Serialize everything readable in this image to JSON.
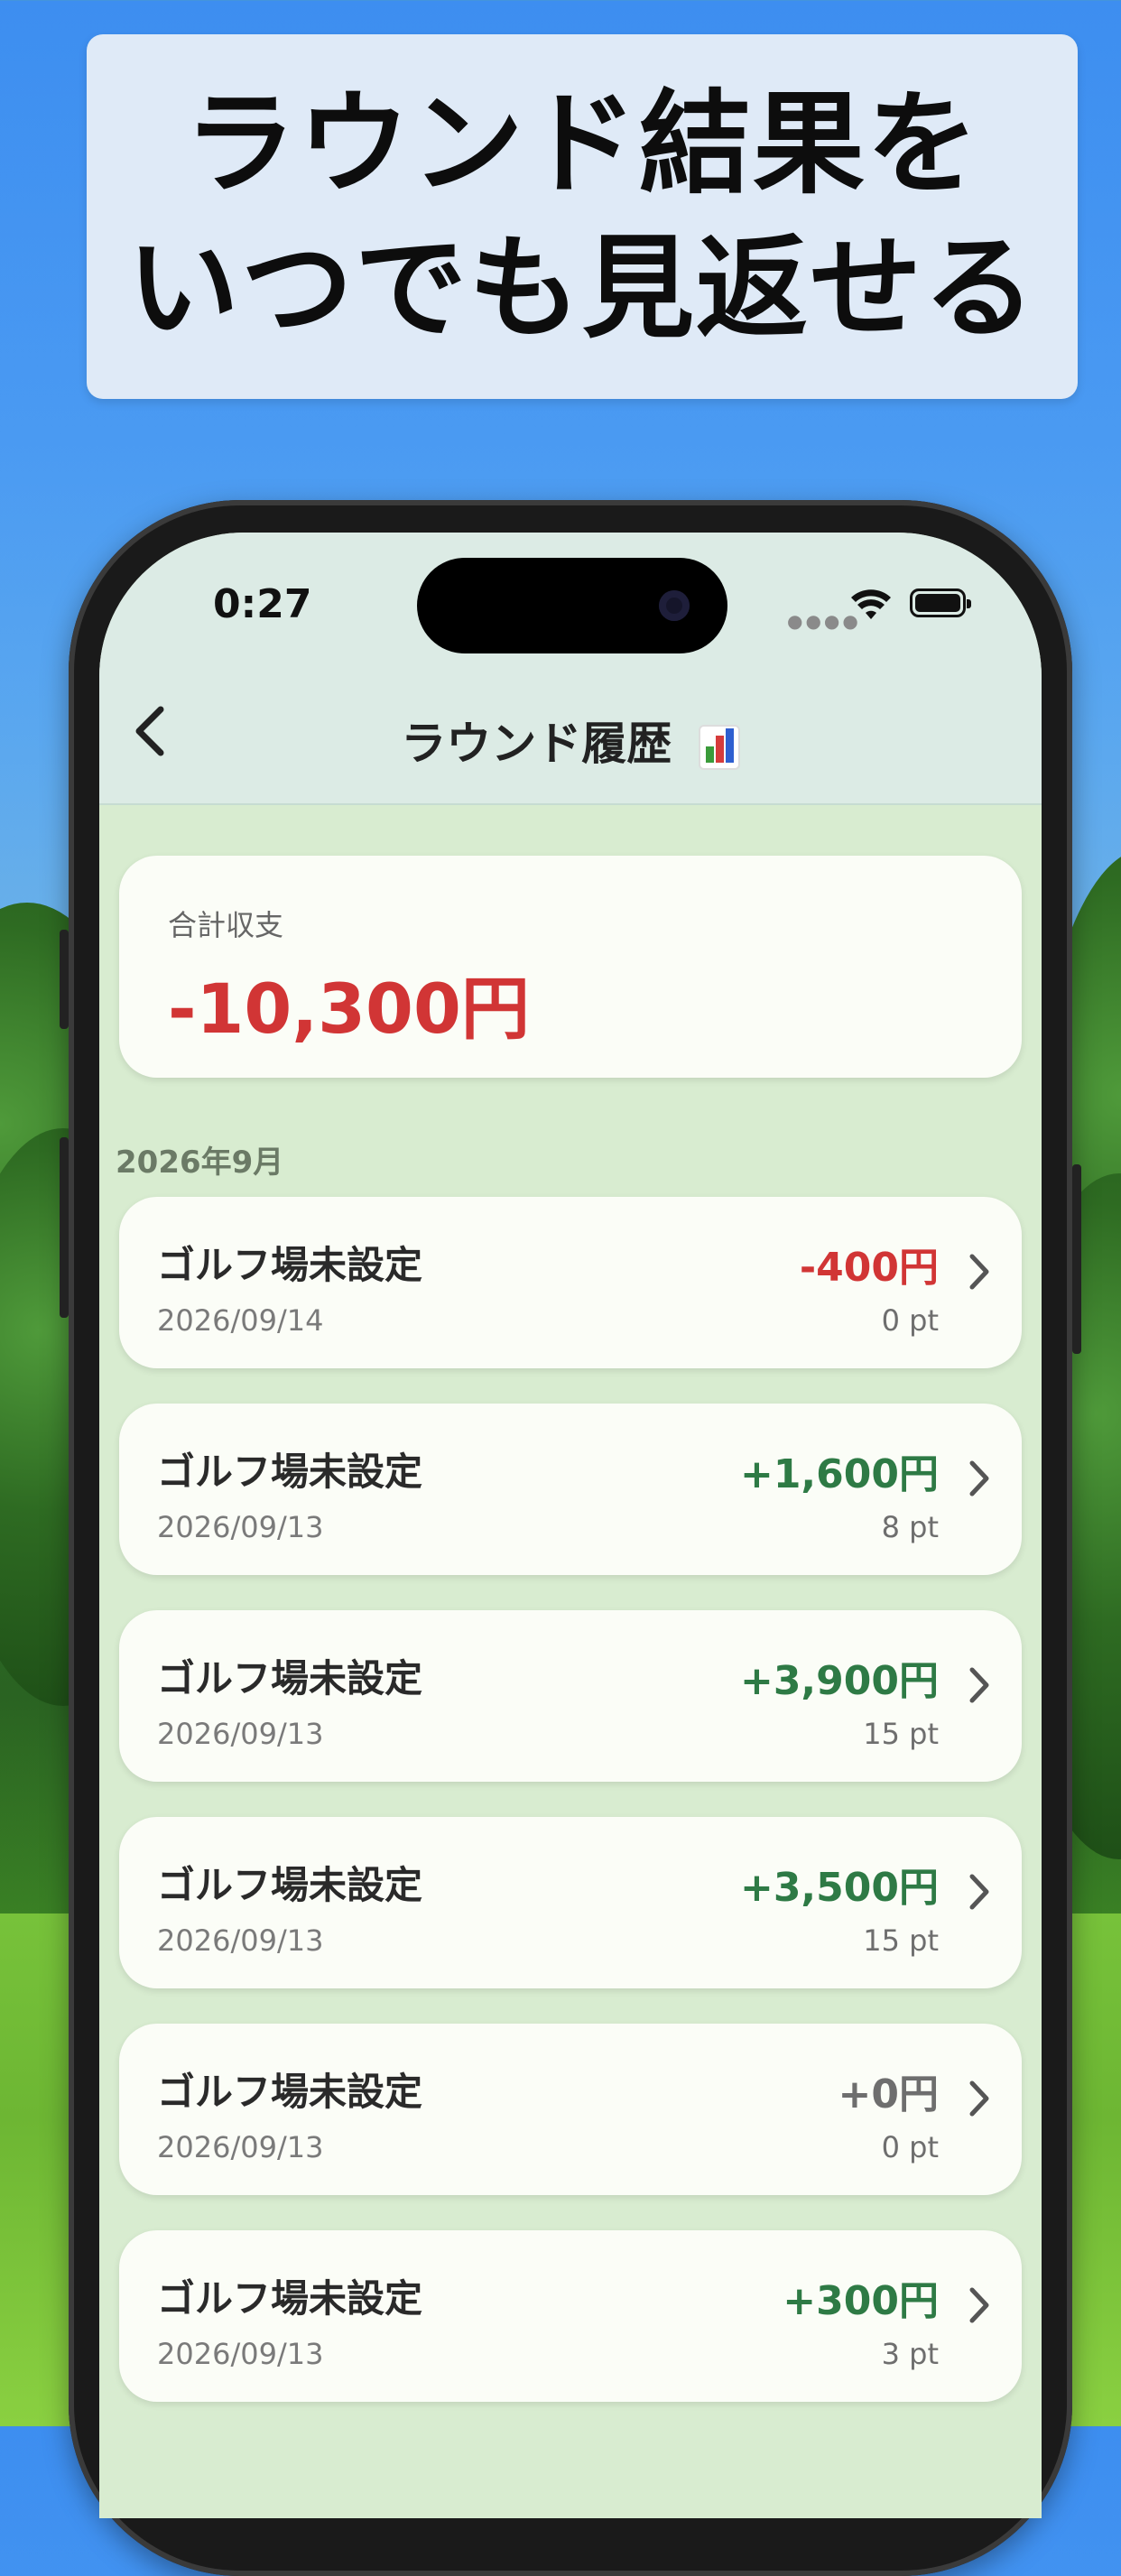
{
  "banner": {
    "line1": "ラウンド結果を",
    "line2": "いつでも見返せる"
  },
  "status": {
    "time": "0:27"
  },
  "nav": {
    "back_glyph": "‹",
    "title": "ラウンド履歴"
  },
  "summary": {
    "label": "合計収支",
    "value": "-10,300円"
  },
  "section_header": "2026年9月",
  "rounds": [
    {
      "name": "ゴルフ場未設定",
      "date": "2026/09/14",
      "amount": "-400円",
      "points": "0 pt",
      "tone": "negative"
    },
    {
      "name": "ゴルフ場未設定",
      "date": "2026/09/13",
      "amount": "+1,600円",
      "points": "8 pt",
      "tone": "positive"
    },
    {
      "name": "ゴルフ場未設定",
      "date": "2026/09/13",
      "amount": "+3,900円",
      "points": "15 pt",
      "tone": "positive"
    },
    {
      "name": "ゴルフ場未設定",
      "date": "2026/09/13",
      "amount": "+3,500円",
      "points": "15 pt",
      "tone": "positive"
    },
    {
      "name": "ゴルフ場未設定",
      "date": "2026/09/13",
      "amount": "+0円",
      "points": "0 pt",
      "tone": "neutral"
    },
    {
      "name": "ゴルフ場未設定",
      "date": "2026/09/13",
      "amount": "+300円",
      "points": "3 pt",
      "tone": "positive"
    }
  ],
  "icons": {
    "back": "chevron-left-icon",
    "row": "chevron-right-icon",
    "title": "bar-chart-icon",
    "wifi": "wifi-icon",
    "battery": "battery-icon"
  },
  "colors": {
    "negative": "#d13535",
    "positive": "#2e7a45",
    "neutral": "#6e6e6e",
    "header_bg": "#dcebe5",
    "list_bg": "#d8ecd0"
  }
}
